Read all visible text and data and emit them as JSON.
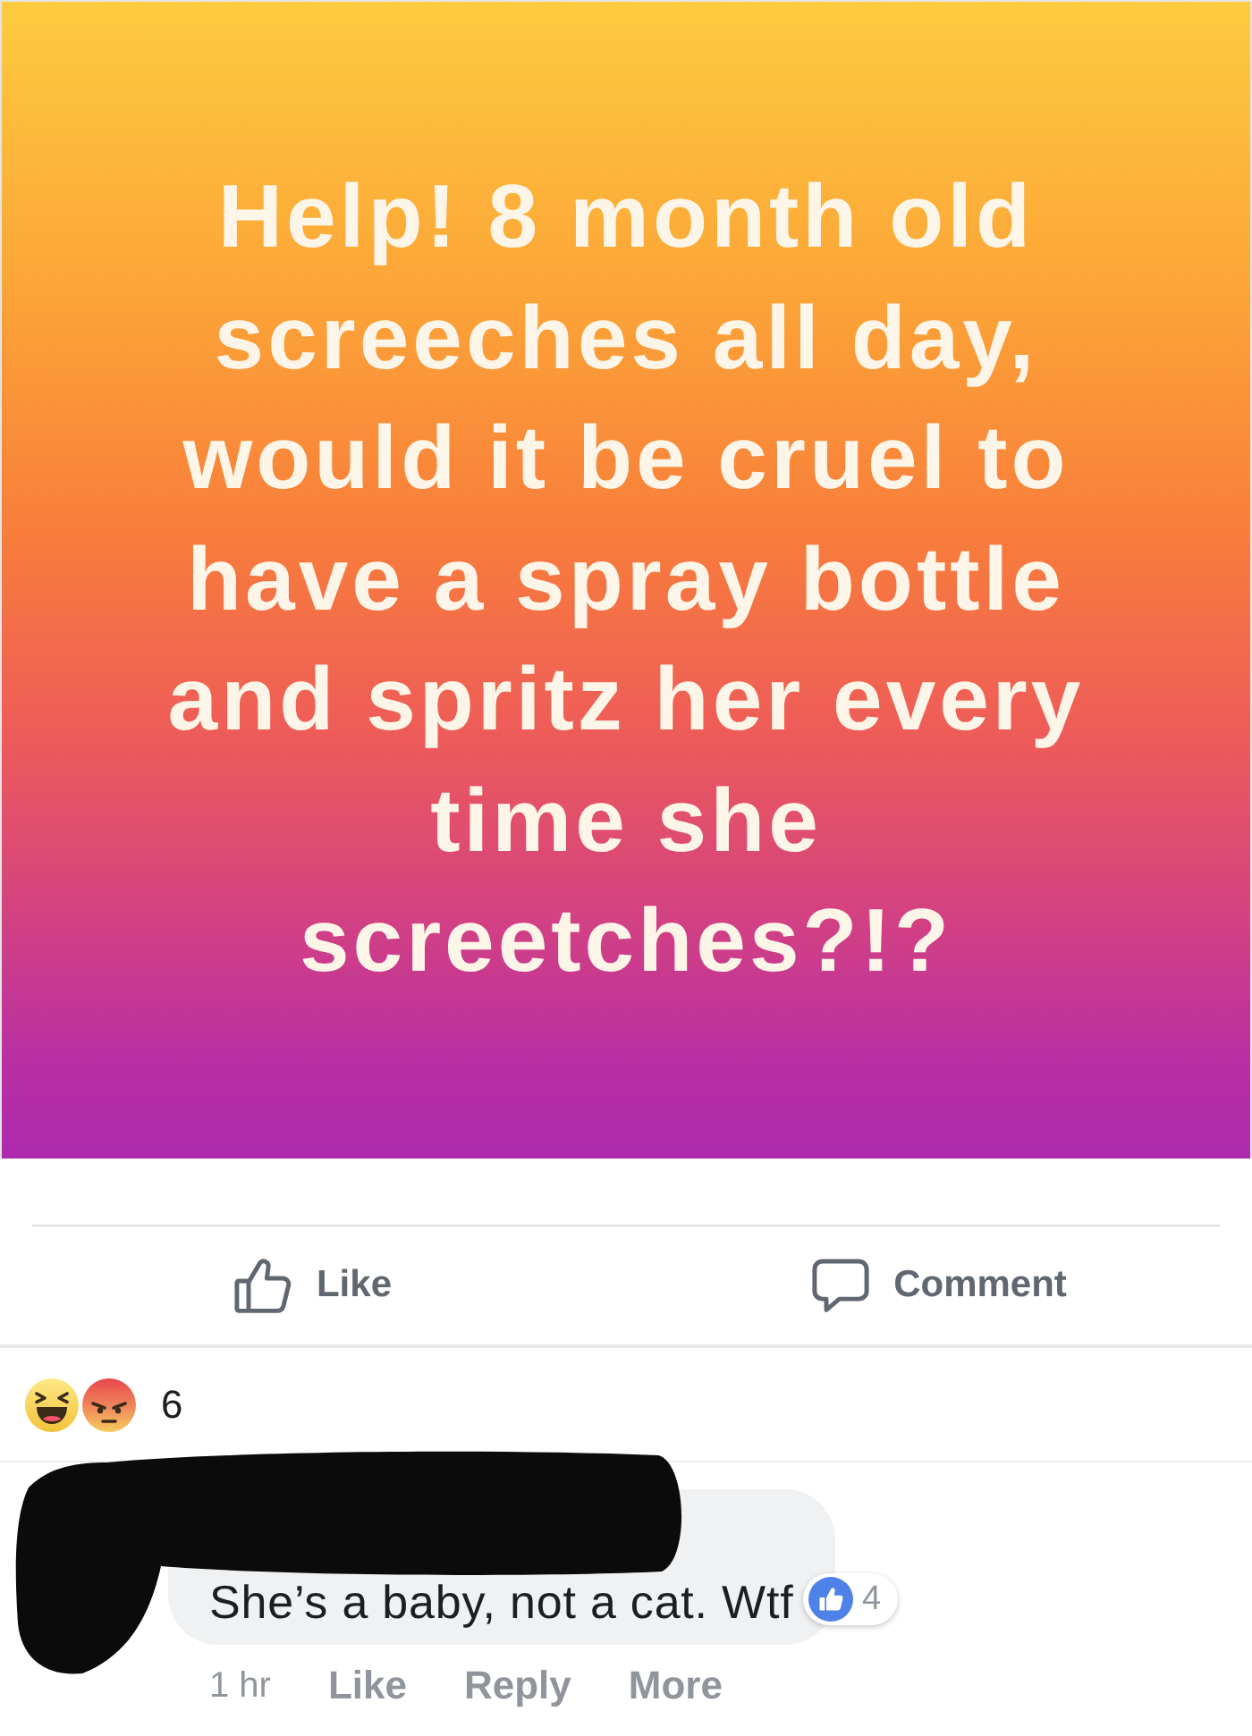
{
  "post": {
    "text": "Help! 8 month old\nscreeches all day,\nwould it be cruel to\nhave a spray bottle\nand spritz her every\ntime she\nscreetches?!?"
  },
  "actions": [
    {
      "kind": "like",
      "label": "Like"
    },
    {
      "kind": "comment",
      "label": "Comment"
    }
  ],
  "reactions": {
    "items": [
      {
        "kind": "haha"
      },
      {
        "kind": "angry"
      }
    ],
    "count": "6"
  },
  "comment": {
    "text": "She’s a baby, not a cat. Wtf",
    "likes": "4",
    "time": "1 hr",
    "actions": [
      "Like",
      "Reply",
      "More"
    ]
  }
}
